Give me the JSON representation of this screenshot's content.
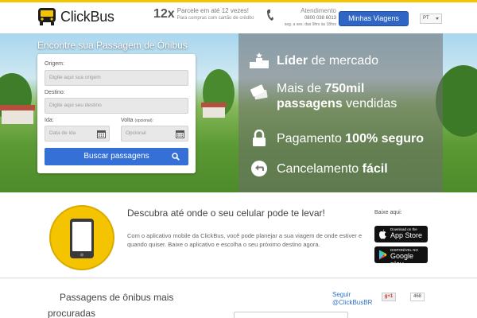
{
  "header": {
    "logo_text": "ClickBus",
    "promo": {
      "big": "12x",
      "line1": "Parcele em até 12 vezes!",
      "line2": "Para compras com cartão de crédito"
    },
    "support": {
      "title": "Atendimento",
      "phone": "0800 038 6013",
      "hours": "seg. a sex. das 9hrs às 18hrs"
    },
    "my_trips_label": "Minhas Viagens",
    "language": "PT"
  },
  "search": {
    "title": "Encontre sua Passagem de Ônibus",
    "origin": {
      "label": "Origem:",
      "placeholder": "Digite aqui sua origem"
    },
    "destination": {
      "label": "Destino:",
      "placeholder": "Digite aqui seu destino"
    },
    "departure": {
      "label": "Ida:",
      "placeholder": "Data de ida"
    },
    "return": {
      "label": "Volta",
      "label_note": "(opcional):",
      "placeholder": "Opcional"
    },
    "submit_label": "Buscar passagens"
  },
  "features": [
    {
      "icon": "podium-icon",
      "lead": "Líder",
      "rest": " de mercado"
    },
    {
      "icon": "tickets-icon",
      "line1_pre": "Mais de ",
      "line1_bold": "750mil",
      "line2_bold": "passagens",
      "line2_rest": " vendidas"
    },
    {
      "icon": "lock-icon",
      "pre": "Pagamento ",
      "bold": "100% seguro"
    },
    {
      "icon": "undo-icon",
      "pre": "Cancelamento ",
      "bold": "fácil"
    }
  ],
  "app": {
    "icon": "smartphone-icon",
    "title": "Descubra até onde o seu celular pode te levar!",
    "description": "Com o aplicativo mobile da ClickBus, você pode planejar a sua viagem de onde estiver e quando quiser. Baixe o aplicativo e escolha o seu próximo destino agora.",
    "download_label": "Baixe aqui:",
    "appstore": {
      "small": "Download on the",
      "big": "App Store"
    },
    "googleplay": {
      "small": "DISPONÍVEL NO",
      "big": "Google play"
    }
  },
  "popular": {
    "title": "Passagens de ônibus mais procuradas"
  },
  "social": {
    "twitter_line1": "Seguir",
    "twitter_line2": "@ClickBusBR",
    "gplus_label": "g+1",
    "gplus_count": "468"
  },
  "colors": {
    "brand_yellow": "#f5c400",
    "brand_blue": "#2f66c6"
  }
}
